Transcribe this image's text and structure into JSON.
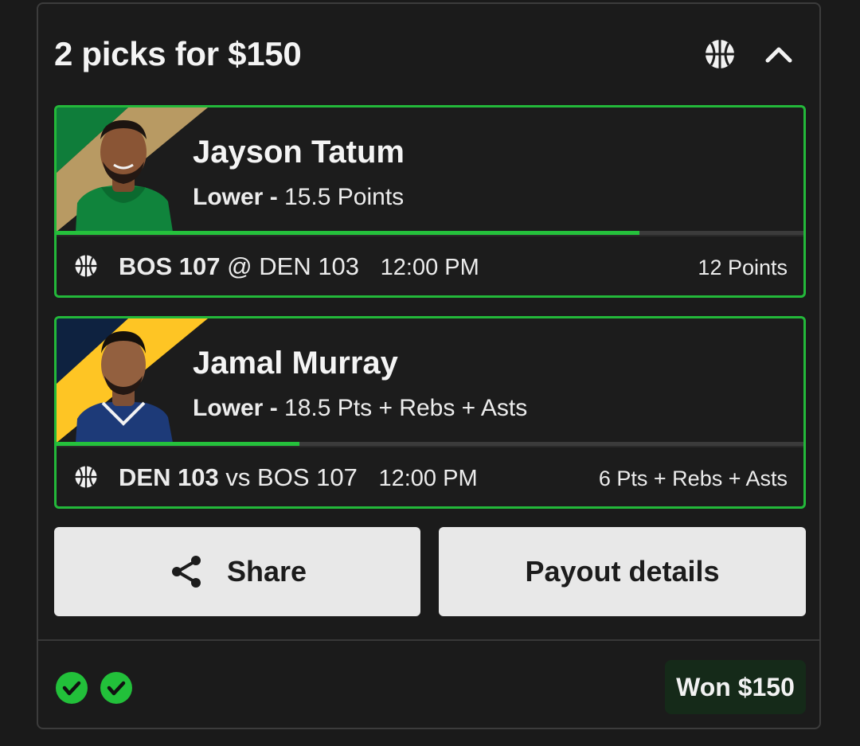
{
  "header": {
    "title": "2 picks for $150",
    "sport_icon": "basketball-icon",
    "collapse_icon": "chevron-up-icon"
  },
  "picks": [
    {
      "player": "Jayson Tatum",
      "direction": "Lower",
      "separator": "-",
      "projection": "15.5 Points",
      "progress": 0.78,
      "team_colors": [
        "#0f7d3a",
        "#b89a63"
      ],
      "home_team": "BOS 107",
      "connector": "@",
      "away_team": "DEN 103",
      "time": "12:00 PM",
      "result": "12 Points"
    },
    {
      "player": "Jamal Murray",
      "direction": "Lower",
      "separator": "-",
      "projection": "18.5 Pts + Rebs + Asts",
      "progress": 0.325,
      "team_colors": [
        "#0e2240",
        "#fec524"
      ],
      "home_team": "DEN 103",
      "connector": "vs",
      "away_team": "BOS 107",
      "time": "12:00 PM",
      "result": "6 Pts + Rebs + Asts"
    }
  ],
  "actions": {
    "share_label": "Share",
    "payout_label": "Payout details"
  },
  "footer": {
    "checks": [
      "check-circle-icon",
      "check-circle-icon"
    ],
    "status": "Won $150",
    "accent": "#22c03a"
  }
}
